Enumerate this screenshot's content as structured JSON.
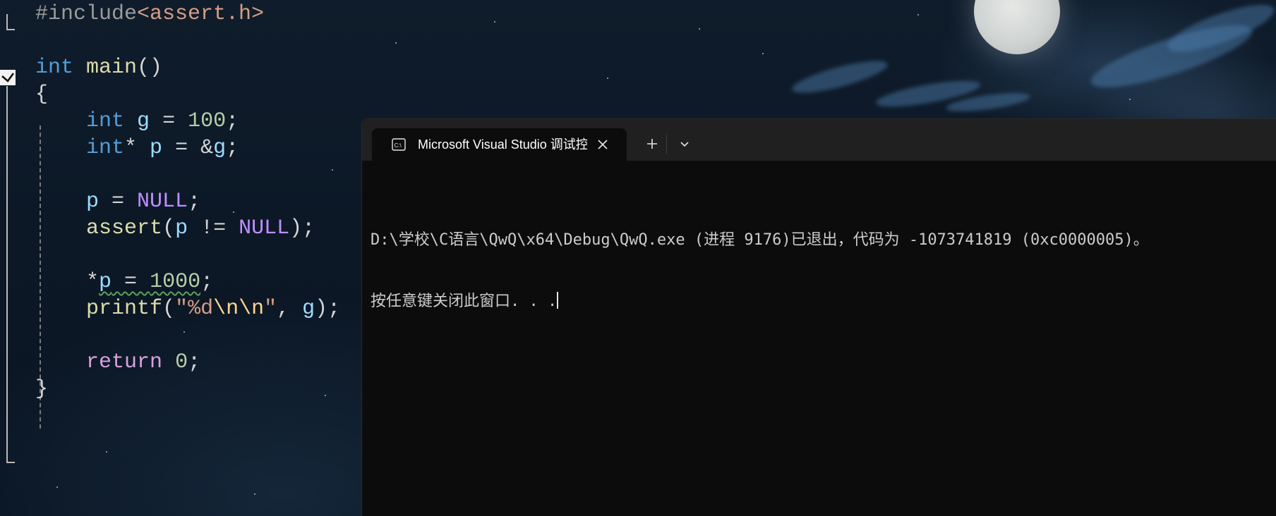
{
  "editor": {
    "lines": [
      [
        {
          "t": "#include",
          "c": "pre"
        },
        {
          "t": "<assert.h>",
          "c": "str"
        }
      ],
      [],
      [
        {
          "t": "int",
          "c": "kw"
        },
        {
          "t": " ",
          "c": "punc"
        },
        {
          "t": "main",
          "c": "fn"
        },
        {
          "t": "()",
          "c": "punc"
        }
      ],
      [
        {
          "t": "{",
          "c": "punc"
        }
      ],
      [
        {
          "t": "    ",
          "c": "punc"
        },
        {
          "t": "int",
          "c": "kw"
        },
        {
          "t": " ",
          "c": "punc"
        },
        {
          "t": "g",
          "c": "var"
        },
        {
          "t": " = ",
          "c": "punc"
        },
        {
          "t": "100",
          "c": "num"
        },
        {
          "t": ";",
          "c": "punc"
        }
      ],
      [
        {
          "t": "    ",
          "c": "punc"
        },
        {
          "t": "int",
          "c": "kw"
        },
        {
          "t": "* ",
          "c": "punc"
        },
        {
          "t": "p",
          "c": "var"
        },
        {
          "t": " = &",
          "c": "punc"
        },
        {
          "t": "g",
          "c": "var"
        },
        {
          "t": ";",
          "c": "punc"
        }
      ],
      [],
      [
        {
          "t": "    ",
          "c": "punc"
        },
        {
          "t": "p",
          "c": "var"
        },
        {
          "t": " = ",
          "c": "punc"
        },
        {
          "t": "NULL",
          "c": "mac"
        },
        {
          "t": ";",
          "c": "punc"
        }
      ],
      [
        {
          "t": "    ",
          "c": "punc"
        },
        {
          "t": "assert",
          "c": "fn"
        },
        {
          "t": "(",
          "c": "punc"
        },
        {
          "t": "p",
          "c": "var"
        },
        {
          "t": " != ",
          "c": "punc"
        },
        {
          "t": "NULL",
          "c": "mac"
        },
        {
          "t": ");",
          "c": "punc"
        }
      ],
      [],
      [
        {
          "t": "    ",
          "c": "punc"
        },
        {
          "t": "*",
          "c": "punc"
        },
        {
          "t": "p",
          "c": "var",
          "u": true
        },
        {
          "t": " = ",
          "c": "punc",
          "u": true
        },
        {
          "t": "1000",
          "c": "num",
          "u": true
        },
        {
          "t": ";",
          "c": "punc"
        }
      ],
      [
        {
          "t": "    ",
          "c": "punc"
        },
        {
          "t": "printf",
          "c": "fn"
        },
        {
          "t": "(",
          "c": "punc"
        },
        {
          "t": "\"%d",
          "c": "str"
        },
        {
          "t": "\\n\\n",
          "c": "esc"
        },
        {
          "t": "\"",
          "c": "str"
        },
        {
          "t": ", ",
          "c": "punc"
        },
        {
          "t": "g",
          "c": "var"
        },
        {
          "t": ");",
          "c": "punc"
        }
      ],
      [],
      [
        {
          "t": "    ",
          "c": "punc"
        },
        {
          "t": "return",
          "c": "ctl"
        },
        {
          "t": " ",
          "c": "punc"
        },
        {
          "t": "0",
          "c": "num"
        },
        {
          "t": ";",
          "c": "punc"
        }
      ],
      [
        {
          "t": "}",
          "c": "punc"
        }
      ]
    ]
  },
  "console": {
    "tab_title": "Microsoft Visual Studio 调试控",
    "tab_icon": "console-icon",
    "close_icon": "close-icon",
    "new_tab_icon": "plus-icon",
    "dropdown_icon": "chevron-down-icon",
    "output_line_1": "D:\\学校\\C语言\\QwQ\\x64\\Debug\\QwQ.exe (进程 9176)已退出，代码为 -1073741819 (0xc0000005)。",
    "output_line_2": "按任意键关闭此窗口. . ."
  },
  "background": {
    "sky_color": "#0c1826",
    "moon_color": "#d8dbd9"
  }
}
